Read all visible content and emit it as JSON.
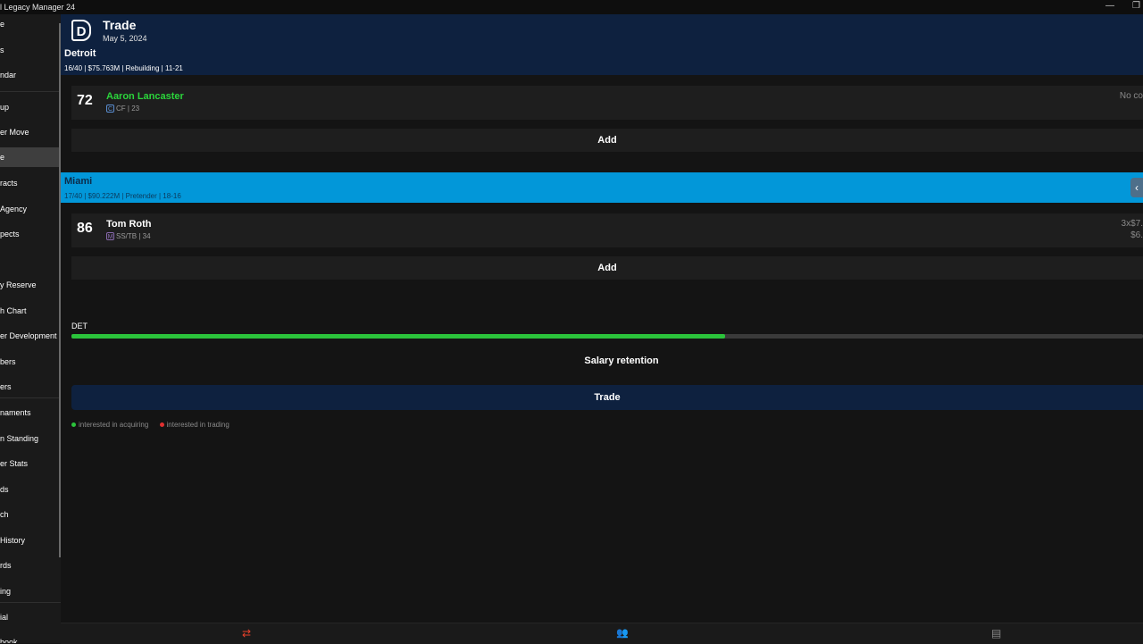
{
  "app": {
    "title": "l Legacy Manager 24"
  },
  "window_controls": {
    "minimize": "—",
    "restore": "❐"
  },
  "sidebar": {
    "items": [
      {
        "label": "e",
        "active": false
      },
      {
        "label": "s",
        "active": false
      },
      {
        "label": "ndar",
        "active": false
      },
      {
        "label": "up",
        "active": false
      },
      {
        "label": "er Move",
        "active": false
      },
      {
        "label": "e",
        "active": true
      },
      {
        "label": "racts",
        "active": false
      },
      {
        "label": "Agency",
        "active": false
      },
      {
        "label": "pects",
        "active": false
      },
      {
        "label": "",
        "active": false
      },
      {
        "label": "y Reserve",
        "active": false
      },
      {
        "label": "h Chart",
        "active": false
      },
      {
        "label": "er Development",
        "active": false
      },
      {
        "label": "bers",
        "active": false
      },
      {
        "label": "ers",
        "active": false
      },
      {
        "label": "naments",
        "active": false
      },
      {
        "label": "n Standing",
        "active": false
      },
      {
        "label": "er Stats",
        "active": false
      },
      {
        "label": "ds",
        "active": false
      },
      {
        "label": "ch",
        "active": false
      },
      {
        "label": " History",
        "active": false
      },
      {
        "label": "rds",
        "active": false
      },
      {
        "label": "ing",
        "active": false
      },
      {
        "label": "ial",
        "active": false
      },
      {
        "label": "book",
        "active": false
      }
    ]
  },
  "header": {
    "logo_letter": "D",
    "title": "Trade",
    "date": "May 5, 2024",
    "team_name": "Detroit",
    "team_info": "16/40 | $75.763M | Rebuilding | 11-21"
  },
  "detroit_player": {
    "ovr": "72",
    "name": "Aaron Lancaster",
    "team_icon": "C",
    "meta": "CF | 23",
    "contract": "No co"
  },
  "add_label": "Add",
  "miami": {
    "name": "Miami",
    "info": "17/40 | $90.222M | Pretender | 18-16",
    "collapse_icon": "‹"
  },
  "miami_player": {
    "ovr": "86",
    "name": "Tom Roth",
    "team_icon": "M",
    "meta": "SS/TB | 34",
    "contract_line1": "3x$7.",
    "contract_line2": "$6."
  },
  "balance": {
    "label": "DET",
    "fill_percent": 61
  },
  "salary_retention_label": "Salary retention",
  "trade_label": "Trade",
  "legend": {
    "acquiring": "interested in acquiring",
    "trading": "interested in trading"
  },
  "colors": {
    "header_bg": "#0e213f",
    "miami_bg": "#0297d9",
    "name_green": "#2bd43b",
    "bar_green": "#2bc33b",
    "acquire_dot": "#2bc33b",
    "trade_dot": "#e03030",
    "bottom_icon_active": "#e8412a"
  },
  "bottom_nav": {
    "trade_icon": "⇄",
    "roster_icon": "👥",
    "book_icon": "▤"
  }
}
